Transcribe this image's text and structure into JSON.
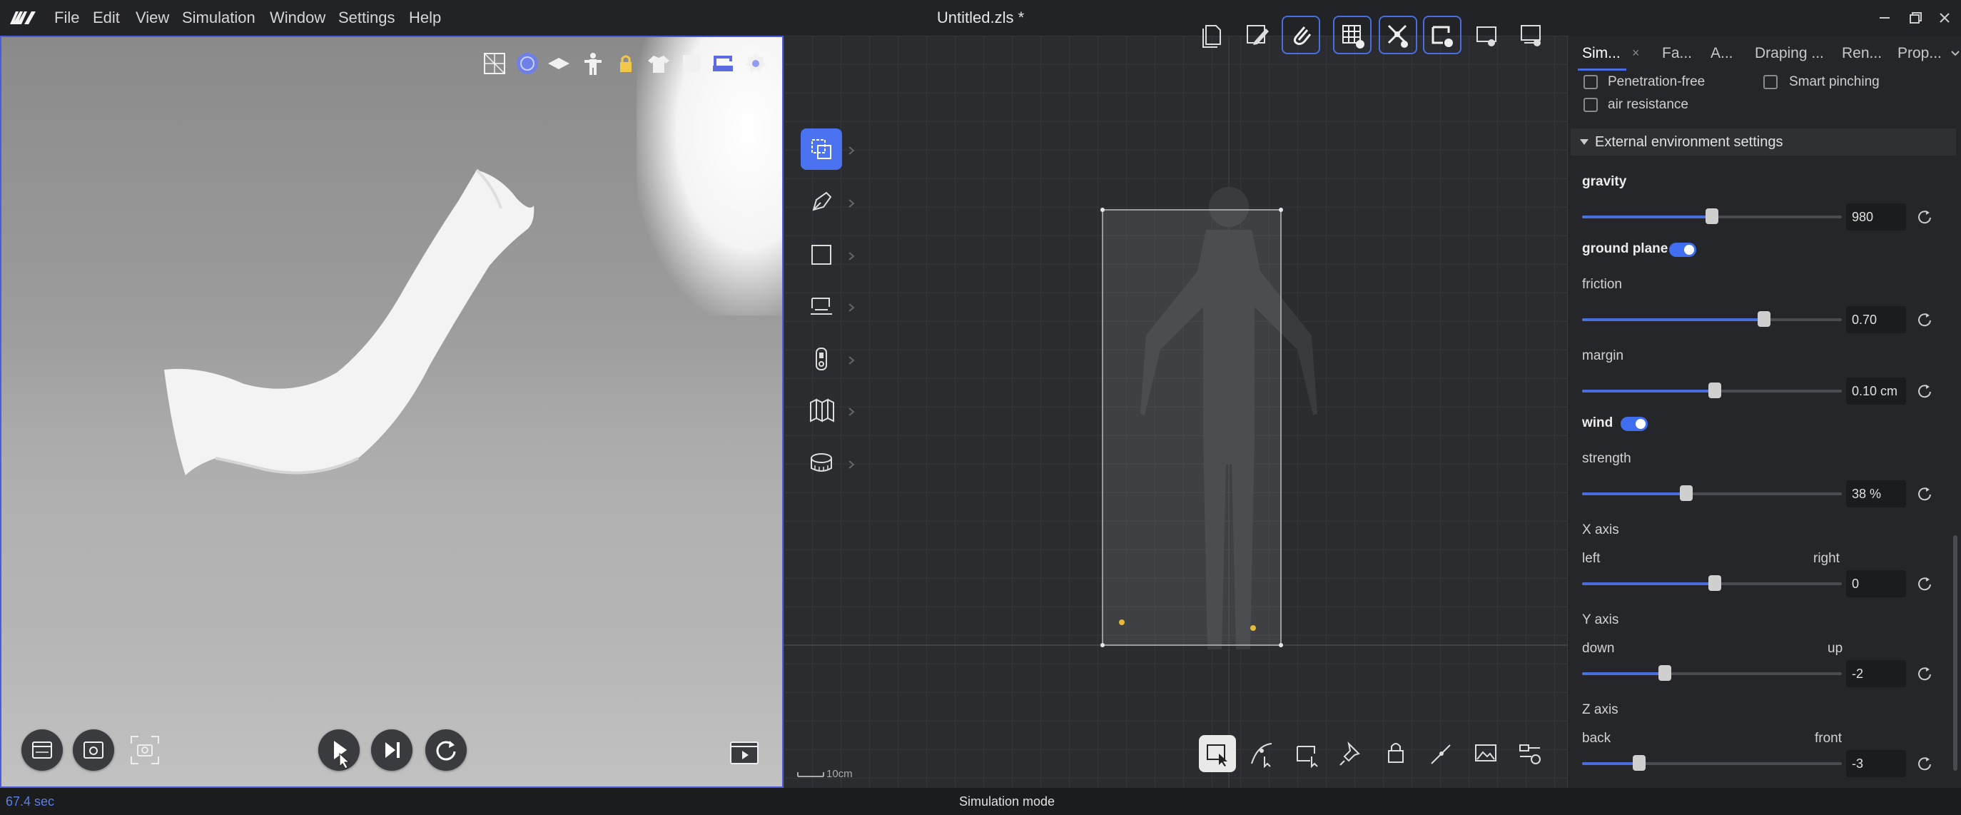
{
  "app": {
    "logo": "app-logo-icon",
    "document_title": "Untitled.zls *"
  },
  "menu": [
    "File",
    "Edit",
    "View",
    "Simulation",
    "Window",
    "Settings",
    "Help"
  ],
  "viewport3d": {
    "top_tools": [
      "mesh-icon",
      "sphere-icon",
      "layer-icon",
      "avatar-icon",
      "lock-icon",
      "garment-icon",
      "box-icon",
      "sewing-machine-icon",
      "badge-icon"
    ],
    "bottom_left_buttons": [
      "render-icon",
      "preview-icon",
      "screenshot-icon"
    ],
    "playback": [
      "play-icon",
      "step-icon",
      "reset-icon"
    ],
    "bottom_right": "video-icon"
  },
  "pattern2d": {
    "top_tools": [
      "page-icon",
      "edit-pattern-icon",
      "attach-icon",
      "grid-view-icon",
      "needle-view-icon",
      "sewing-view-icon",
      "pattern-view-icon",
      "avatar-view-icon"
    ],
    "left_tools": [
      "transform-icon",
      "pen-icon",
      "rectangle-icon",
      "sewing-icon",
      "zipper-icon",
      "fold-icon",
      "measure-icon"
    ],
    "bottom_tools": [
      "select-icon",
      "curve-icon",
      "sew-icon",
      "pin-icon",
      "lock-icon",
      "line-icon",
      "image-icon",
      "settings-icon"
    ],
    "scale_label": "10cm"
  },
  "panel": {
    "tabs": [
      {
        "label": "Sim...",
        "active": true,
        "closable": true
      },
      {
        "label": "Fa..."
      },
      {
        "label": "A..."
      },
      {
        "label": "Draping ..."
      },
      {
        "label": "Ren..."
      },
      {
        "label": "Prop..."
      }
    ],
    "checkboxes": {
      "penetration_free": "Penetration-free",
      "smart_pinching": "Smart pinching",
      "air_resistance": "air resistance"
    },
    "section_title": "External environment settings",
    "gravity": {
      "label": "gravity",
      "value": "980",
      "fraction": 0.5
    },
    "ground_plane": {
      "label": "ground plane",
      "enabled": true
    },
    "friction": {
      "label": "friction",
      "value": "0.70",
      "fraction": 0.7
    },
    "margin": {
      "label": "margin",
      "value": "0.10 cm",
      "fraction": 0.51
    },
    "wind": {
      "label": "wind",
      "enabled": true
    },
    "strength": {
      "label": "strength",
      "value": "38 %",
      "fraction": 0.4
    },
    "x_axis": {
      "label": "X axis",
      "left": "left",
      "right": "right",
      "value": "0",
      "fraction": 0.51
    },
    "y_axis": {
      "label": "Y axis",
      "left": "down",
      "right": "up",
      "value": "-2",
      "fraction": 0.32
    },
    "z_axis": {
      "label": "Z axis",
      "left": "back",
      "right": "front",
      "value": "-3",
      "fraction": 0.22
    }
  },
  "status": {
    "time": "67.4 sec",
    "mode": "Simulation mode"
  },
  "colors": {
    "accent": "#4a6ee0",
    "time": "#5b7ee8"
  }
}
